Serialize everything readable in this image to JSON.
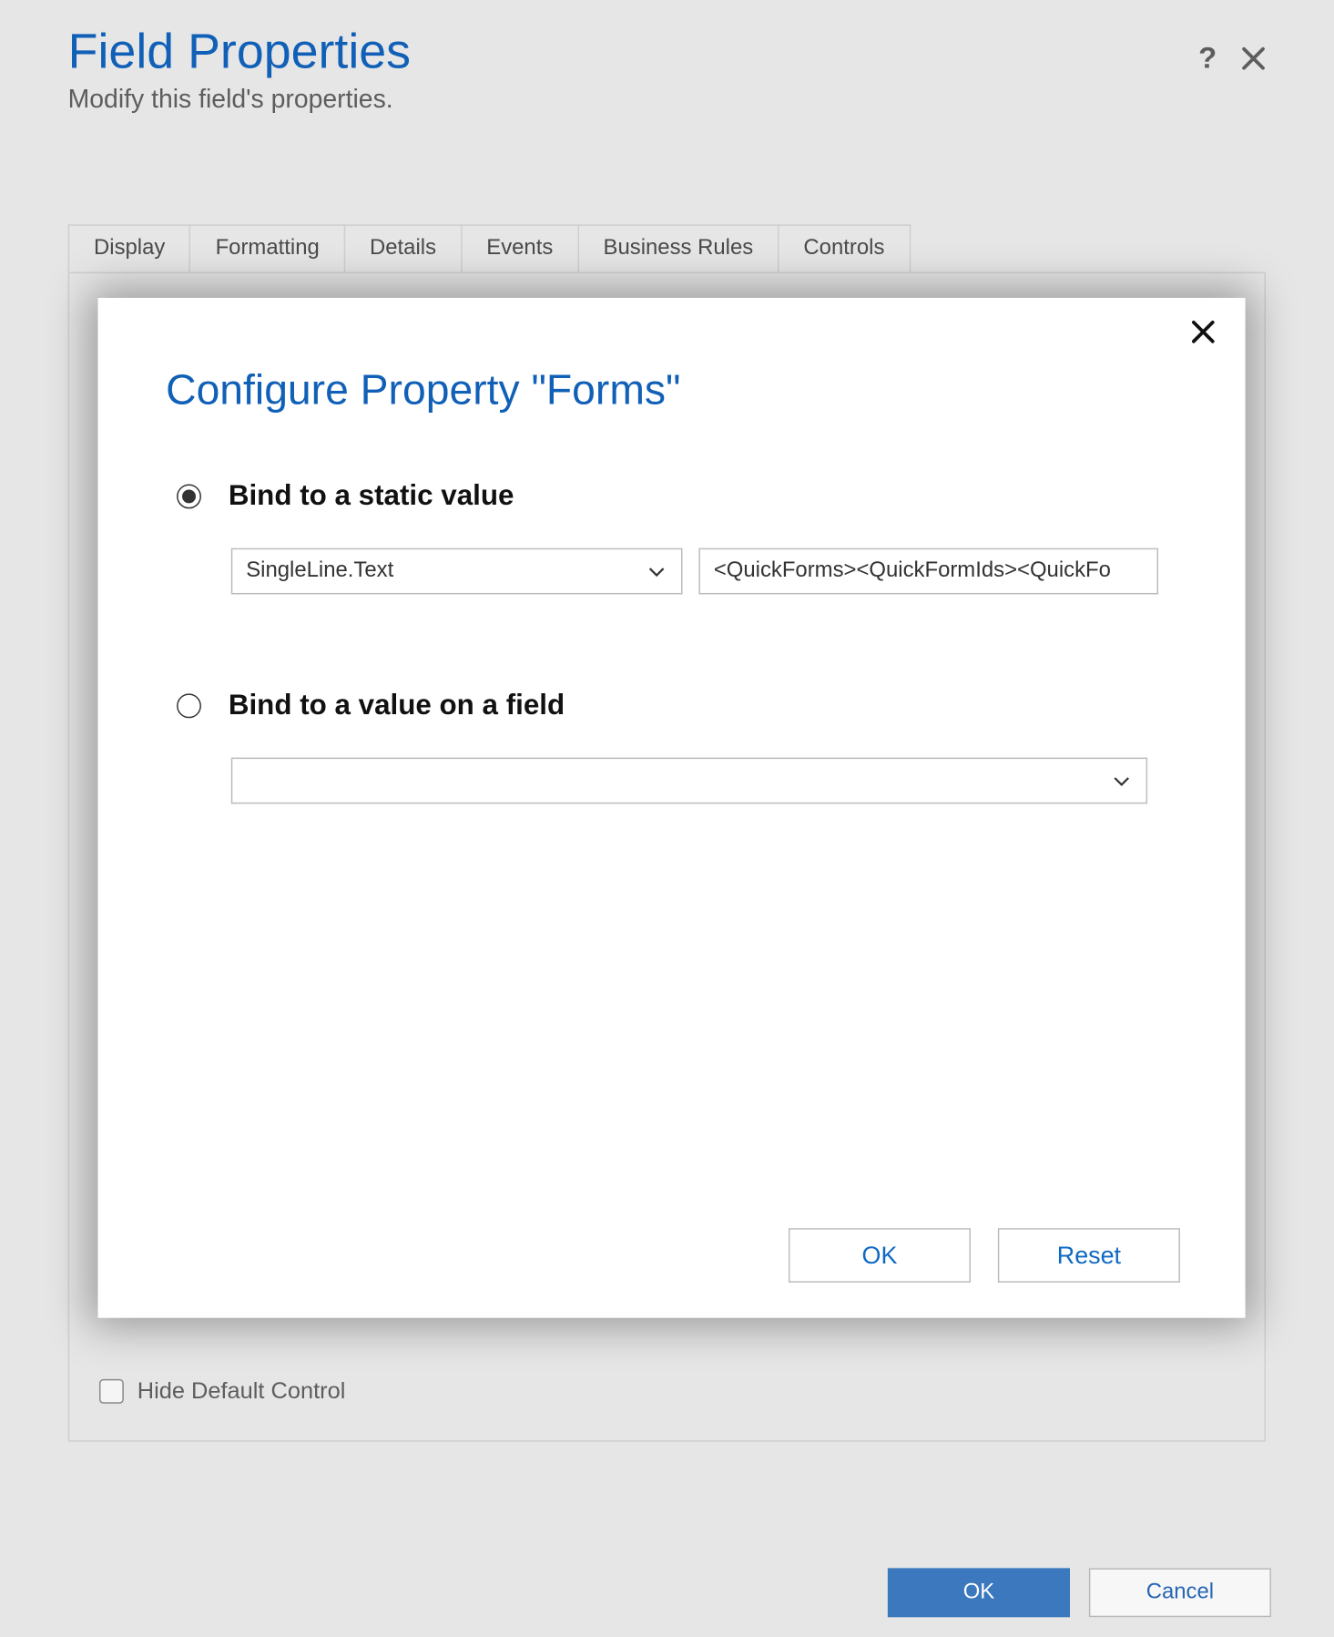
{
  "header": {
    "title": "Field Properties",
    "subtitle": "Modify this field's properties."
  },
  "tabs": [
    {
      "label": "Display"
    },
    {
      "label": "Formatting"
    },
    {
      "label": "Details"
    },
    {
      "label": "Events"
    },
    {
      "label": "Business Rules"
    },
    {
      "label": "Controls"
    }
  ],
  "panel": {
    "hide_default_label": "Hide Default Control"
  },
  "footer": {
    "ok": "OK",
    "cancel": "Cancel"
  },
  "modal": {
    "title": "Configure Property \"Forms\"",
    "static_option_label": "Bind to a static value",
    "static_type_value": "SingleLine.Text",
    "static_text_value": "<QuickForms><QuickFormIds><QuickFo",
    "field_option_label": "Bind to a value on a field",
    "field_select_value": "",
    "ok": "OK",
    "reset": "Reset"
  }
}
